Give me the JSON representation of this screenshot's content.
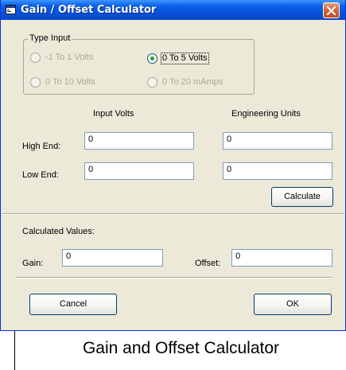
{
  "window": {
    "title": "Gain / Offset Calculator",
    "title_icon": "app-window-icon",
    "close_icon": "close-icon"
  },
  "type_input": {
    "legend": "Type Input",
    "options": [
      {
        "label": "-1 To 1 Volts",
        "selected": false,
        "enabled": false
      },
      {
        "label": "0 To 5 Volts",
        "selected": true,
        "enabled": true
      },
      {
        "label": "0 To 10 Volts",
        "selected": false,
        "enabled": false
      },
      {
        "label": "0 To 20 mAmps",
        "selected": false,
        "enabled": false
      }
    ]
  },
  "columns": {
    "input_volts": "Input Volts",
    "engineering_units": "Engineering Units"
  },
  "rows": {
    "high_end": {
      "label": "High End:",
      "input_volts": "0",
      "engineering_units": "0"
    },
    "low_end": {
      "label": "Low End:",
      "input_volts": "0",
      "engineering_units": "0"
    }
  },
  "calculate_label": "Calculate",
  "calculated": {
    "heading": "Calculated Values:",
    "gain_label": "Gain:",
    "gain_value": "0",
    "offset_label": "Offset:",
    "offset_value": "0"
  },
  "footer": {
    "cancel_label": "Cancel",
    "ok_label": "OK"
  },
  "caption": "Gain and Offset Calculator",
  "colors": {
    "titlebar": "#0a5fe6",
    "dialog_bg": "#ece9d8",
    "close_button": "#d66a3e",
    "radio_selected": "#21a121"
  }
}
